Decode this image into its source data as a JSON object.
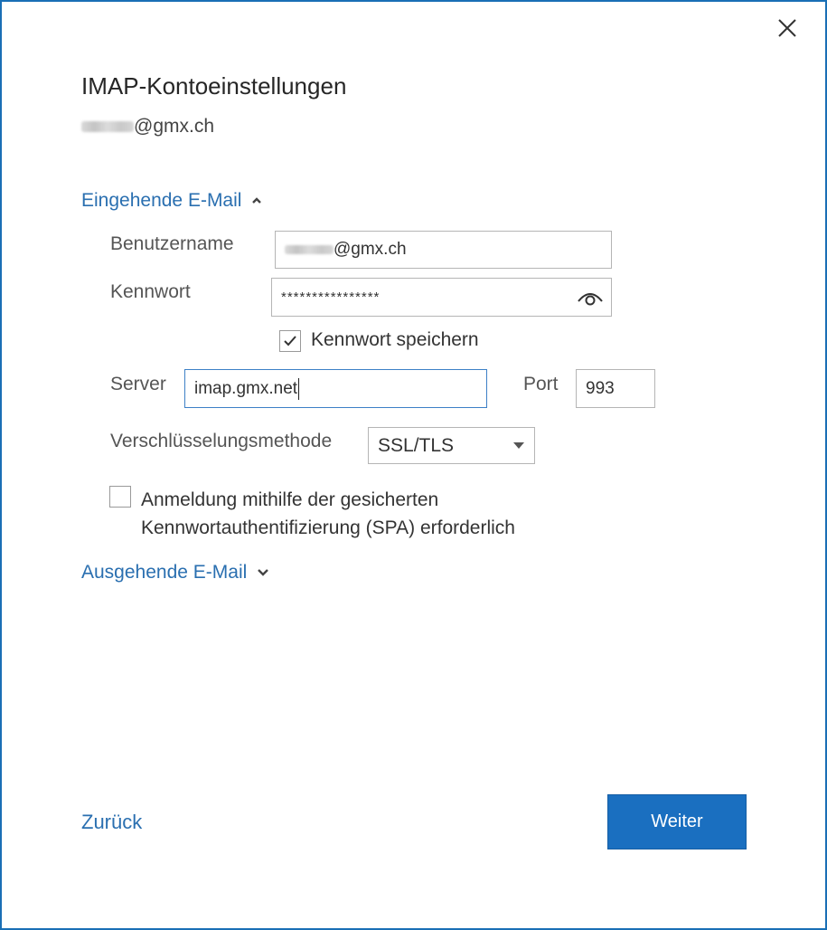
{
  "dialog": {
    "title": "IMAP-Kontoeinstellungen",
    "account_suffix": "@gmx.ch",
    "close_icon": "close-icon"
  },
  "incoming": {
    "section_label": "Eingehende E-Mail",
    "expanded": true,
    "username_label": "Benutzername",
    "username_suffix": "@gmx.ch",
    "password_label": "Kennwort",
    "password_value": "****************",
    "save_password_label": "Kennwort speichern",
    "save_password_checked": true,
    "server_label": "Server",
    "server_value": "imap.gmx.net",
    "port_label": "Port",
    "port_value": "993",
    "encryption_label": "Verschlüsselungsmethode",
    "encryption_value": "SSL/TLS",
    "spa_label_line1": "Anmeldung mithilfe der gesicherten",
    "spa_label_line2": "Kennwortauthentifizierung (SPA) erforderlich",
    "spa_checked": false
  },
  "outgoing": {
    "section_label": "Ausgehende E-Mail",
    "expanded": false
  },
  "footer": {
    "back_label": "Zurück",
    "next_label": "Weiter"
  },
  "colors": {
    "accent": "#1a6fc0",
    "link": "#2a6fb0",
    "border": "#1a6fb5"
  }
}
